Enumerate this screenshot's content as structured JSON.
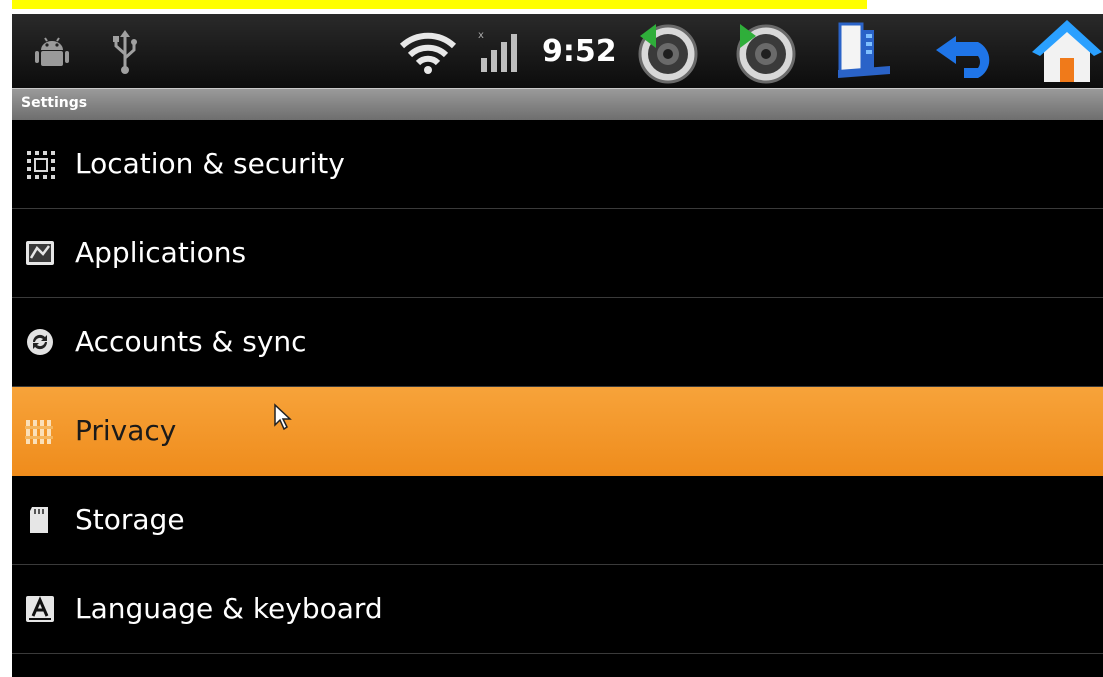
{
  "caption": {
    "color": "#ffff00"
  },
  "statusbar": {
    "time": "9:52",
    "left_icons": [
      "android-debug-icon",
      "usb-icon"
    ],
    "right_icons": [
      "wifi-icon",
      "signal-icon",
      "volume-down-icon",
      "volume-up-icon",
      "menu-icon",
      "back-icon",
      "home-icon"
    ]
  },
  "header": {
    "title": "Settings"
  },
  "settings": {
    "items": [
      {
        "label": "Location & security",
        "icon": "location-security-icon"
      },
      {
        "label": "Applications",
        "icon": "applications-icon"
      },
      {
        "label": "Accounts & sync",
        "icon": "accounts-sync-icon"
      },
      {
        "label": "Privacy",
        "icon": "privacy-icon",
        "selected": true
      },
      {
        "label": "Storage",
        "icon": "storage-icon"
      },
      {
        "label": "Language & keyboard",
        "icon": "language-keyboard-icon"
      }
    ]
  },
  "colors": {
    "selected": "#f39a2a",
    "background": "#000000",
    "header": "#8a8a8a"
  }
}
